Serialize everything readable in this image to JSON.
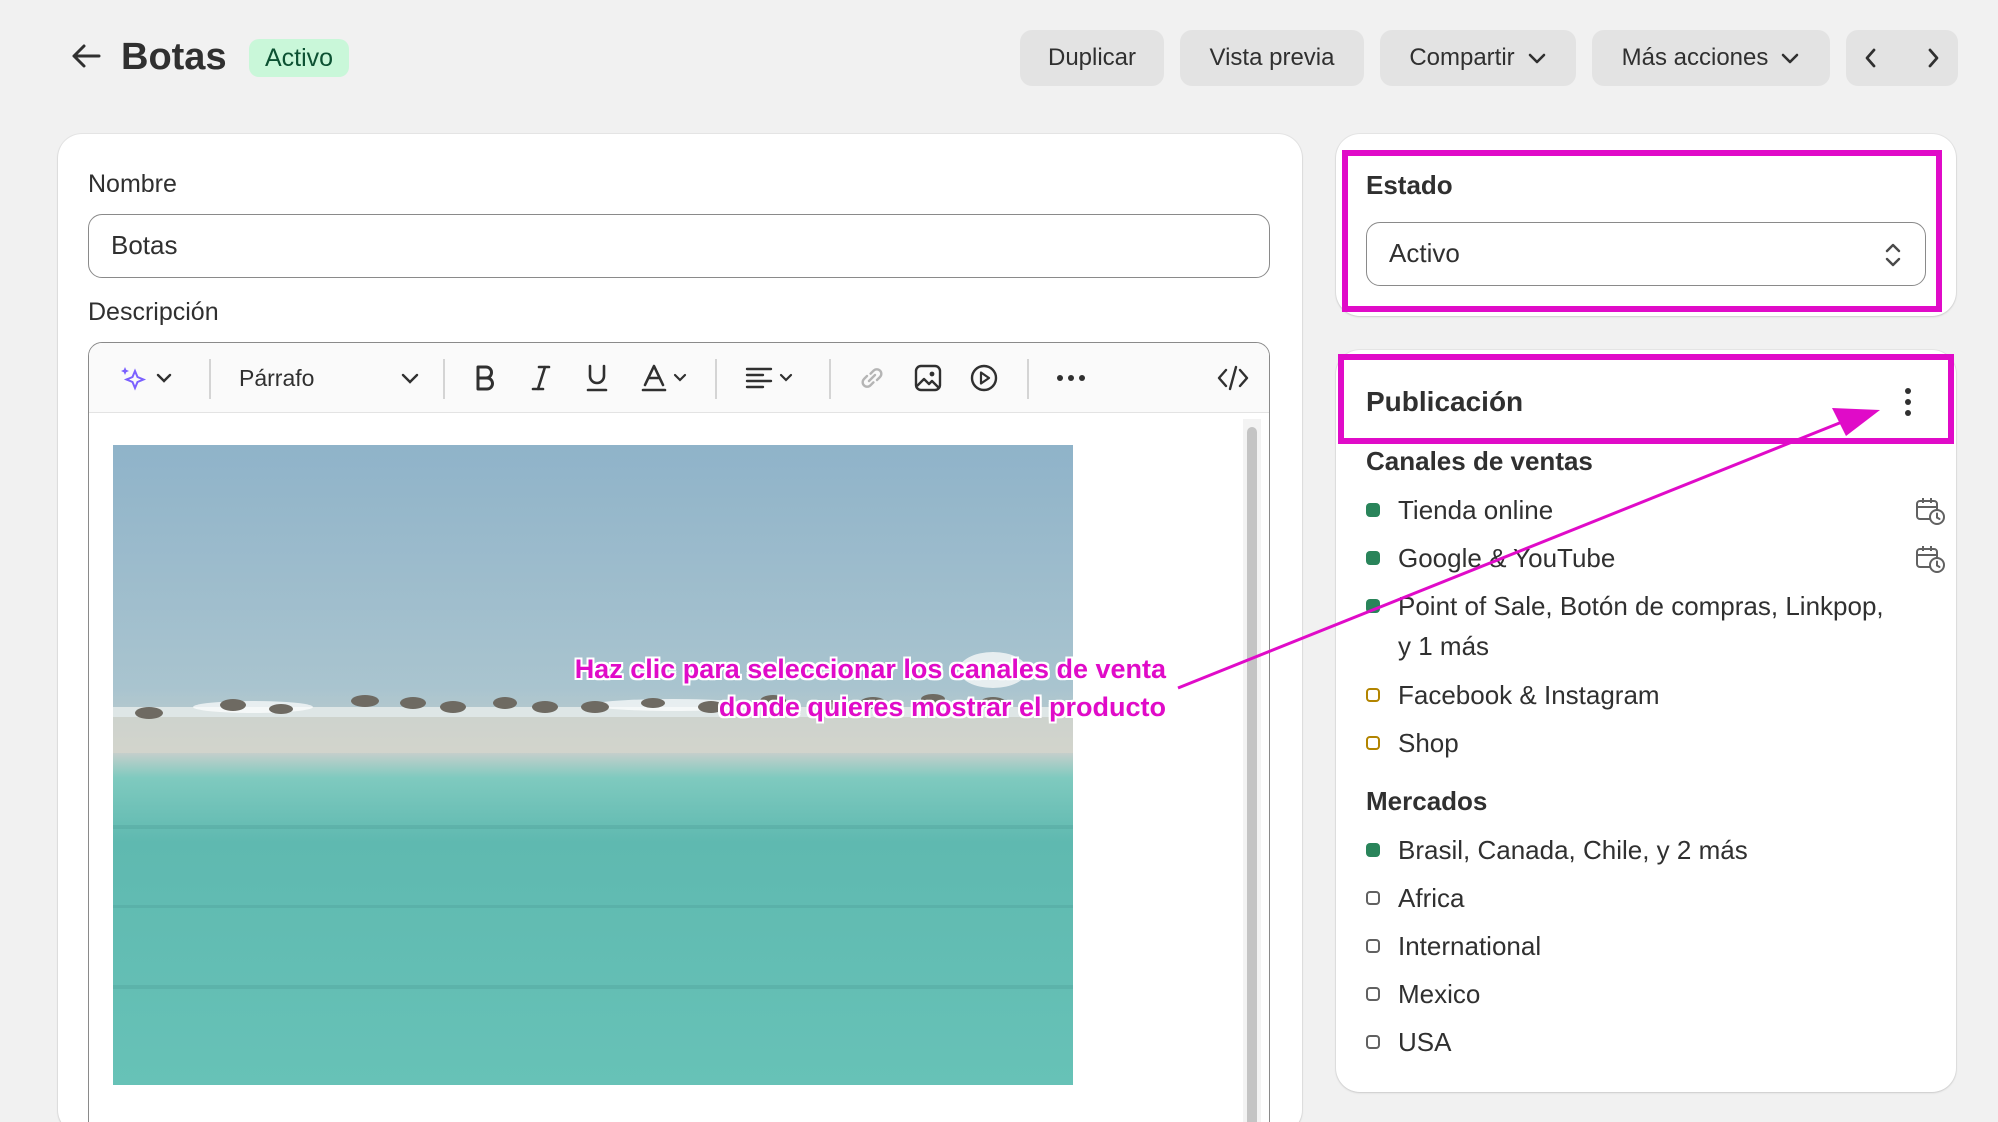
{
  "header": {
    "title": "Botas",
    "status_badge": "Activo",
    "buttons": {
      "duplicate": "Duplicar",
      "preview": "Vista previa",
      "share": "Compartir",
      "more_actions": "Más acciones"
    }
  },
  "main": {
    "name_label": "Nombre",
    "name_value": "Botas",
    "description_label": "Descripción",
    "toolbar": {
      "paragraph": "Párrafo"
    }
  },
  "estado": {
    "title": "Estado",
    "selected": "Activo"
  },
  "publicacion": {
    "title": "Publicación",
    "sales_channels_title": "Canales de ventas",
    "sales_channels": [
      {
        "label": "Tienda online",
        "status": "active"
      },
      {
        "label": "Google & YouTube",
        "status": "active"
      },
      {
        "label": "Point of Sale, Botón de compras, Linkpop,",
        "label2": "y 1 más",
        "status": "active"
      },
      {
        "label": "Facebook & Instagram",
        "status": "pending"
      },
      {
        "label": "Shop",
        "status": "pending"
      }
    ],
    "markets_title": "Mercados",
    "markets": [
      {
        "label": "Brasil, Canada, Chile, y 2 más",
        "status": "active"
      },
      {
        "label": "Africa",
        "status": "inactive"
      },
      {
        "label": "International",
        "status": "inactive"
      },
      {
        "label": "Mexico",
        "status": "inactive"
      },
      {
        "label": "USA",
        "status": "inactive"
      }
    ]
  },
  "annotation": {
    "line1": "Haz clic para seleccionar los canales de venta",
    "line2": "donde quieres mostrar el producto",
    "color": "#e00bc8"
  },
  "colors": {
    "active_dot": "#29845a",
    "pending_dot": "#b28400",
    "badge_bg": "#c9f7d9",
    "highlight": "#e00bc8"
  }
}
